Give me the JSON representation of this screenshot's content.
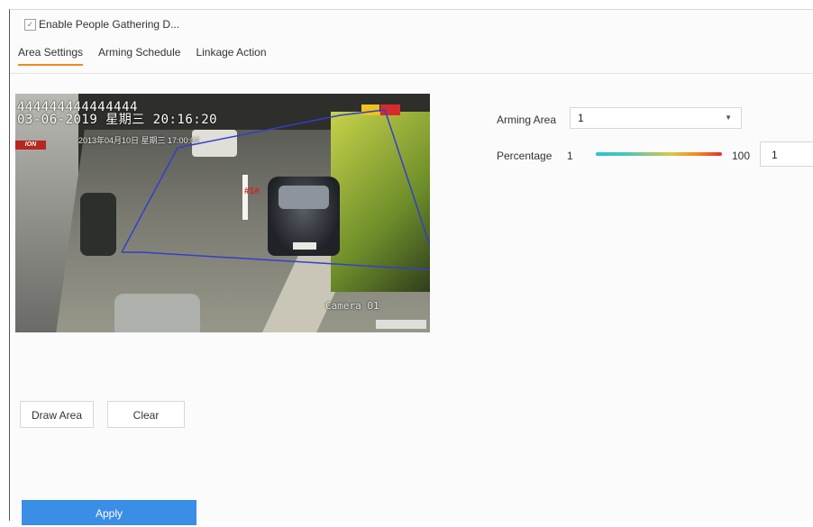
{
  "header": {
    "enable_label": "Enable People Gathering D..."
  },
  "tabs": [
    {
      "label": "Area Settings",
      "active": true
    },
    {
      "label": "Arming Schedule",
      "active": false
    },
    {
      "label": "Linkage Action",
      "active": false
    }
  ],
  "video": {
    "osd_line1": "444444444444444",
    "osd_line2": "03-06-2019 星期三 20:16:20",
    "camera_label": "Camera 01",
    "object_label": "#1#",
    "inner_osd": "2013年04月10日 星期三 17:00:02",
    "brand_text": "ION"
  },
  "arming_area": {
    "label": "Arming Area",
    "value": "1"
  },
  "percentage": {
    "label": "Percentage",
    "min": "1",
    "max": "100",
    "value": "1"
  },
  "buttons": {
    "draw": "Draw Area",
    "clear": "Clear",
    "apply": "Apply"
  },
  "colors": {
    "accent": "#f08a24",
    "apply": "#3a8ee6",
    "polygon": "#3340c8"
  }
}
